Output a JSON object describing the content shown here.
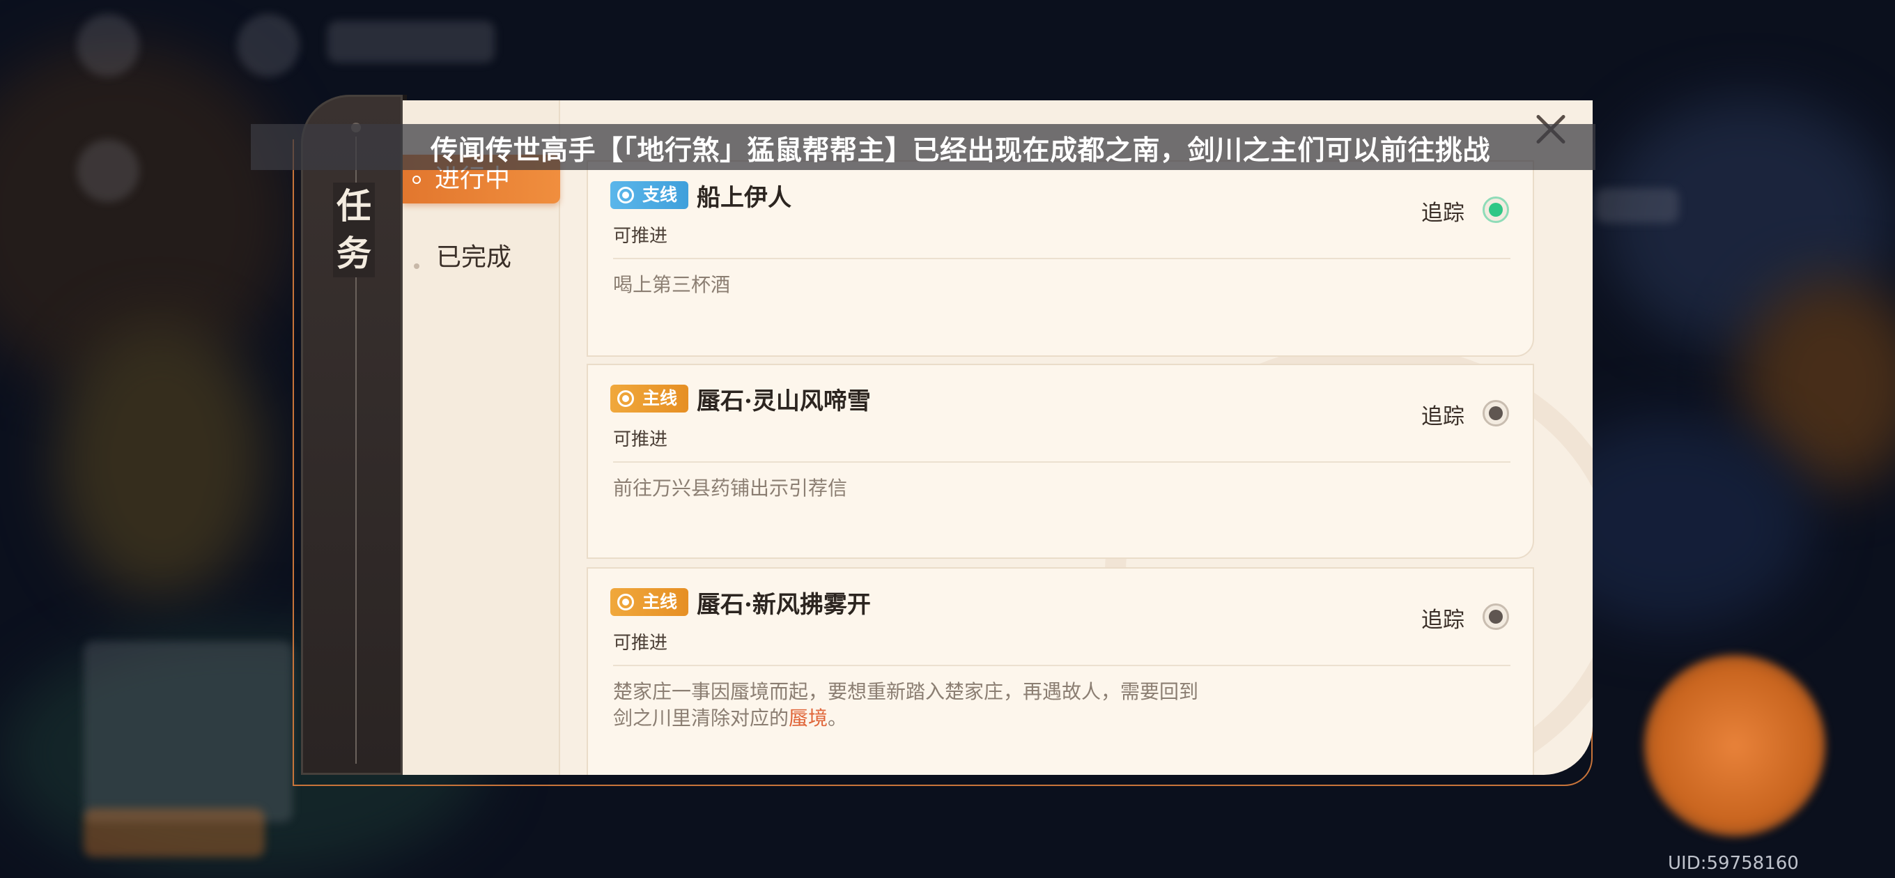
{
  "notice": {
    "text": "传闻传世高手【「地行煞」猛鼠帮帮主】已经出现在成都之南，剑川之主们可以前往挑战"
  },
  "sidebar": {
    "title": "任务"
  },
  "nav": {
    "active_label": "进行中",
    "completed_label": "已完成"
  },
  "quests": [
    {
      "badge": "支线",
      "badge_type": "side",
      "title": "船上伊人",
      "status": "可推进",
      "description": "喝上第三杯酒",
      "track_label": "追踪",
      "tracked": true
    },
    {
      "badge": "主线",
      "badge_type": "main",
      "title": "蜃石·灵山风啼雪",
      "status": "可推进",
      "description": "前往万兴县药铺出示引荐信",
      "track_label": "追踪",
      "tracked": false
    },
    {
      "badge": "主线",
      "badge_type": "main",
      "title": "蜃石·新风拂雾开",
      "status": "可推进",
      "description_line1": "楚家庄一事因蜃境而起，要想重新踏入楚家庄，再遇故人，需要回到",
      "description_line2_prefix": "剑之川里清除对应的",
      "description_highlight": "蜃境",
      "description_line2_suffix": "。",
      "track_label": "追踪",
      "tracked": false
    }
  ],
  "footer": {
    "uid": "UID:59758160"
  },
  "colors": {
    "accent": "#e2772e",
    "side_badge": "#3fa0db",
    "main_badge": "#e68f24",
    "tracked": "#2fc786",
    "highlight": "#e0663a"
  }
}
